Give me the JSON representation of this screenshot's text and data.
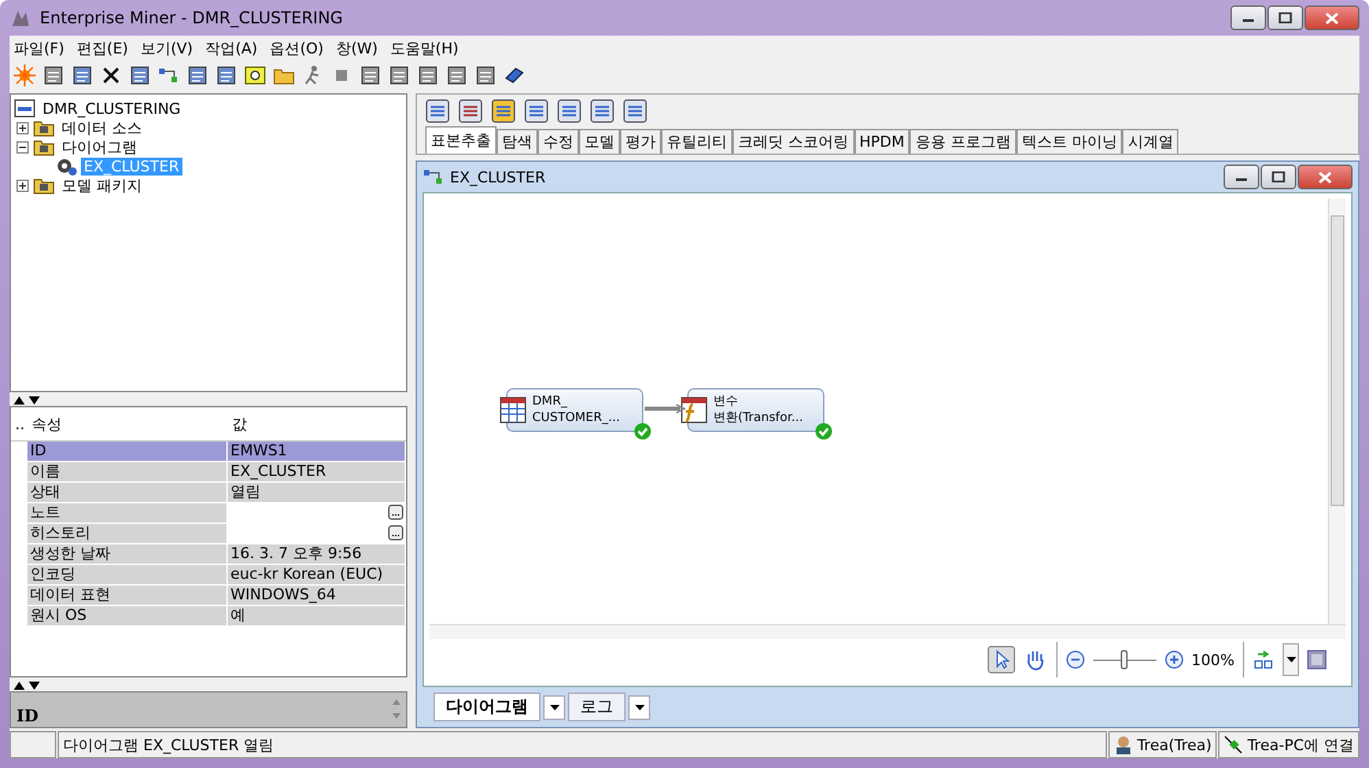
{
  "window": {
    "title": "Enterprise Miner - DMR_CLUSTERING"
  },
  "menu": [
    "파일(F)",
    "편집(E)",
    "보기(V)",
    "작업(A)",
    "옵션(O)",
    "창(W)",
    "도움말(H)"
  ],
  "project_tree": {
    "label": "DMR_CLUSTERING",
    "children": [
      {
        "label": "데이터 소스",
        "expanded": false,
        "selected": false
      },
      {
        "label": "다이어그램",
        "expanded": true,
        "selected": false,
        "children": [
          {
            "label": "EX_CLUSTER",
            "selected": true
          }
        ]
      },
      {
        "label": "모델 패키지",
        "expanded": false,
        "selected": false
      }
    ]
  },
  "properties": {
    "columns": [
      "..",
      "속성",
      "값"
    ],
    "rows": [
      {
        "name": "ID",
        "value": "EMWS1",
        "selected": true,
        "editable": false
      },
      {
        "name": "이름",
        "value": "EX_CLUSTER",
        "selected": false,
        "editable": false
      },
      {
        "name": "상태",
        "value": "열림",
        "selected": false,
        "editable": false
      },
      {
        "name": "노트",
        "value": "",
        "selected": false,
        "editable": true
      },
      {
        "name": "히스토리",
        "value": "",
        "selected": false,
        "editable": true
      },
      {
        "name": "생성한 날짜",
        "value": "16. 3. 7 오후 9:56",
        "selected": false,
        "editable": false
      },
      {
        "name": "인코딩",
        "value": "euc-kr  Korean (EUC)",
        "selected": false,
        "editable": false
      },
      {
        "name": "데이터 표현",
        "value": "WINDOWS_64",
        "selected": false,
        "editable": false
      },
      {
        "name": "원시 OS",
        "value": "예",
        "selected": false,
        "editable": false
      }
    ]
  },
  "description": {
    "title": "ID"
  },
  "node_tabs": [
    {
      "label": "표본추출",
      "selected": true
    },
    {
      "label": "탐색",
      "selected": false
    },
    {
      "label": "수정",
      "selected": false
    },
    {
      "label": "모델",
      "selected": false
    },
    {
      "label": "평가",
      "selected": false
    },
    {
      "label": "유틸리티",
      "selected": false
    },
    {
      "label": "크레딧 스코어링",
      "selected": false
    },
    {
      "label": "HPDM",
      "selected": false
    },
    {
      "label": "응용 프로그램",
      "selected": false
    },
    {
      "label": "텍스트 마이닝",
      "selected": false
    },
    {
      "label": "시계열",
      "selected": false
    }
  ],
  "diagram_window": {
    "title": "EX_CLUSTER",
    "nodes": [
      {
        "kind": "data",
        "line1": "DMR_",
        "line2": "CUSTOMER_...",
        "completed": true
      },
      {
        "kind": "transform",
        "line1": "변수",
        "line2": "변환(Transfor...",
        "completed": true
      }
    ],
    "zoom": {
      "level": 0.5,
      "reading": "100%"
    },
    "bottom_tabs": [
      {
        "label": "다이어그램",
        "selected": true
      },
      {
        "label": "로그",
        "selected": false
      }
    ]
  },
  "status_bar": {
    "message": "다이어그램 EX_CLUSTER 열림",
    "user": "Trea(Trea)",
    "connection": "Trea-PC에 연결"
  }
}
